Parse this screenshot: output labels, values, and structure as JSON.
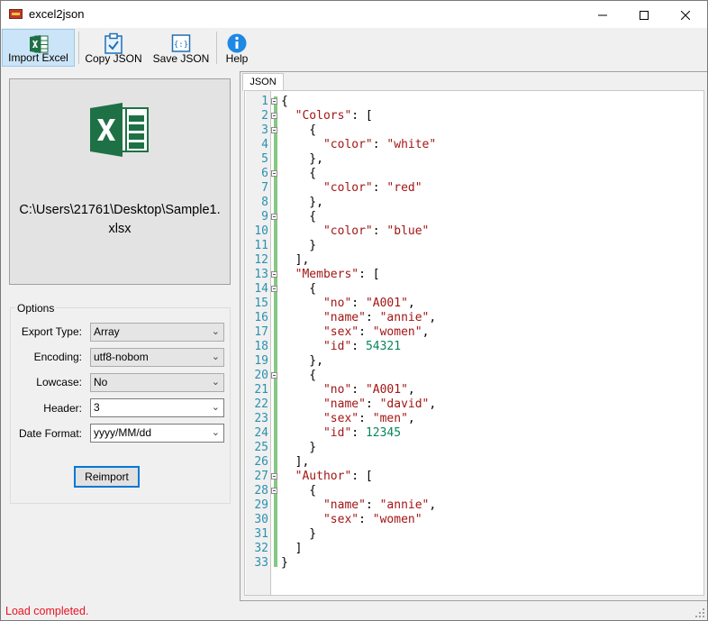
{
  "window": {
    "title": "excel2json"
  },
  "toolbar": {
    "import_label": "Import Excel",
    "copy_label": "Copy JSON",
    "save_label": "Save JSON",
    "help_label": "Help"
  },
  "file": {
    "path_line1": "C:\\Users\\21761\\Desktop\\Sample1.",
    "path_line2": "xlsx"
  },
  "options": {
    "legend": "Options",
    "export_type_label": "Export Type:",
    "export_type_value": "Array",
    "encoding_label": "Encoding:",
    "encoding_value": "utf8-nobom",
    "lowcase_label": "Lowcase:",
    "lowcase_value": "No",
    "header_label": "Header:",
    "header_value": "3",
    "date_format_label": "Date Format:",
    "date_format_value": "yyyy/MM/dd",
    "reimport_label": "Reimport"
  },
  "editor": {
    "tab_label": "JSON",
    "lines": [
      "{",
      "  \"Colors\": [",
      "    {",
      "      \"color\": \"white\"",
      "    },",
      "    {",
      "      \"color\": \"red\"",
      "    },",
      "    {",
      "      \"color\": \"blue\"",
      "    }",
      "  ],",
      "  \"Members\": [",
      "    {",
      "      \"no\": \"A001\",",
      "      \"name\": \"annie\",",
      "      \"sex\": \"women\",",
      "      \"id\": 54321",
      "    },",
      "    {",
      "      \"no\": \"A001\",",
      "      \"name\": \"david\",",
      "      \"sex\": \"men\",",
      "      \"id\": 12345",
      "    }",
      "  ],",
      "  \"Author\": [",
      "    {",
      "      \"name\": \"annie\",",
      "      \"sex\": \"women\"",
      "    }",
      "  ]",
      "}"
    ],
    "fold_lines": [
      1,
      2,
      3,
      6,
      9,
      13,
      14,
      20,
      27,
      28
    ]
  },
  "status": {
    "text": "Load completed."
  },
  "colors": {
    "status_error": "#e81123",
    "excel_green": "#1e7145",
    "help_blue": "#1e88e5",
    "string": "#a31515",
    "number": "#098658",
    "line_number": "#2b91af"
  }
}
